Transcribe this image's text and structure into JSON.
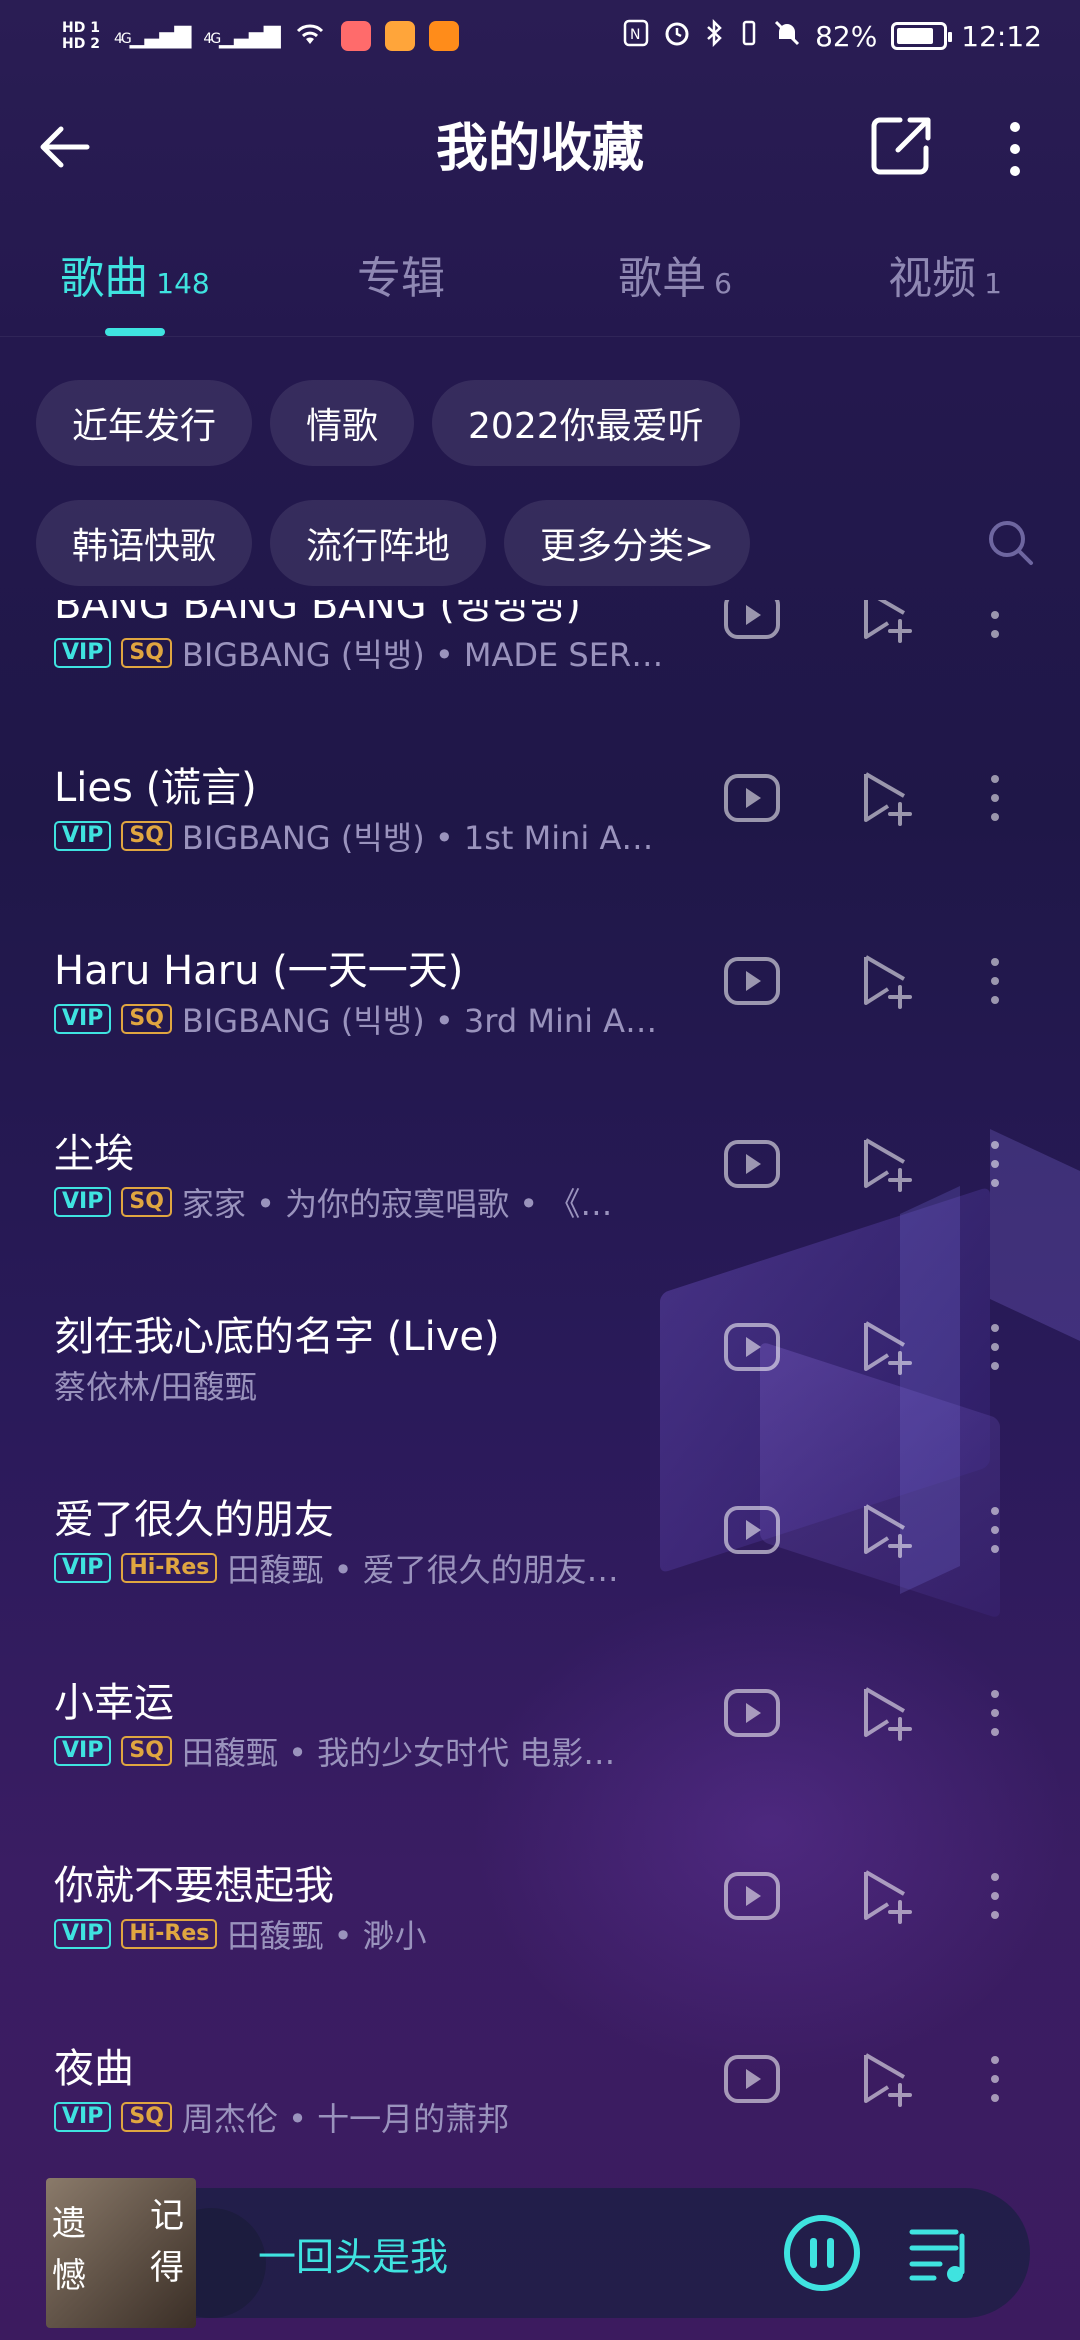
{
  "status_bar": {
    "hd1": "HD 1",
    "hd2": "HD 2",
    "signal1": "4G",
    "signal2": "4G",
    "battery_pct": "82%",
    "battery_level": 0.82,
    "time": "12:12"
  },
  "header": {
    "title": "我的收藏"
  },
  "tabs": [
    {
      "label": "歌曲",
      "count": "148",
      "active": true
    },
    {
      "label": "专辑",
      "count": ""
    },
    {
      "label": "歌单",
      "count": "6"
    },
    {
      "label": "视频",
      "count": "1"
    }
  ],
  "chips": {
    "row1": [
      "近年发行",
      "情歌",
      "2022你最爱听"
    ],
    "row2": [
      "韩语快歌",
      "流行阵地",
      "更多分类>"
    ]
  },
  "songs": [
    {
      "title": "BANG BANG BANG (뱅뱅뱅)",
      "badges": [
        "VIP",
        "SQ"
      ],
      "subtitle": "BIGBANG (빅뱅) • MADE SER…"
    },
    {
      "title": "Lies (谎言)",
      "badges": [
        "VIP",
        "SQ"
      ],
      "subtitle": "BIGBANG (빅뱅) • 1st Mini A…"
    },
    {
      "title": "Haru Haru (一天一天)",
      "badges": [
        "VIP",
        "SQ"
      ],
      "subtitle": "BIGBANG (빅뱅) • 3rd Mini A…"
    },
    {
      "title": "尘埃",
      "badges": [
        "VIP",
        "SQ"
      ],
      "subtitle": "家家 • 为你的寂寞唱歌 • 《…"
    },
    {
      "title": "刻在我心底的名字 (Live)",
      "badges": [],
      "subtitle": "蔡依林/田馥甄"
    },
    {
      "title": "爱了很久的朋友",
      "badges": [
        "VIP",
        "Hi-Res"
      ],
      "subtitle": "田馥甄 • 爱了很久的朋友…"
    },
    {
      "title": "小幸运",
      "badges": [
        "VIP",
        "SQ"
      ],
      "subtitle": "田馥甄 • 我的少女时代 电影…"
    },
    {
      "title": "你就不要想起我",
      "badges": [
        "VIP",
        "Hi-Res"
      ],
      "subtitle": "田馥甄 • 渺小"
    },
    {
      "title": "夜曲",
      "badges": [
        "VIP",
        "SQ"
      ],
      "subtitle": "周杰伦 • 十一月的萧邦"
    }
  ],
  "player": {
    "now_playing": "一回头是我",
    "cover_chars": [
      "遗",
      "憾",
      "记",
      "得"
    ]
  },
  "colors": {
    "accent": "#3fe3e0",
    "quality_badge": "#e0a640",
    "secondary_text": "#9a93bd"
  }
}
